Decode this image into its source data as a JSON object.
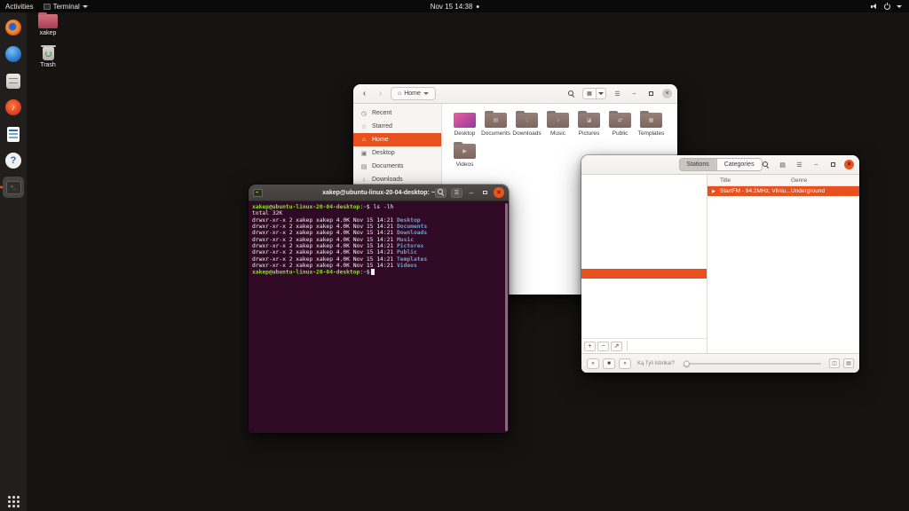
{
  "topbar": {
    "activities": "Activities",
    "app_name": "Terminal",
    "clock": "Nov 15 14:38"
  },
  "desktop": {
    "icons": [
      {
        "label": "xakep"
      },
      {
        "label": "Trash"
      }
    ]
  },
  "dock": {
    "apps": [
      "firefox",
      "thunderbird",
      "files",
      "rhythmbox",
      "libreoffice-writer",
      "help",
      "terminal"
    ],
    "bottom": "show-applications"
  },
  "files": {
    "location": "Home",
    "sidebar": [
      {
        "label": "Recent"
      },
      {
        "label": "Starred"
      },
      {
        "label": "Home",
        "selected": true
      },
      {
        "label": "Desktop"
      },
      {
        "label": "Documents"
      },
      {
        "label": "Downloads"
      }
    ],
    "folders": [
      {
        "name": "Desktop"
      },
      {
        "name": "Documents"
      },
      {
        "name": "Downloads"
      },
      {
        "name": "Music"
      },
      {
        "name": "Pictures"
      },
      {
        "name": "Public"
      },
      {
        "name": "Templates"
      },
      {
        "name": "Videos"
      }
    ]
  },
  "radio": {
    "tabs": {
      "stations": "Stations",
      "categories": "Categories"
    },
    "columns": {
      "title": "Title",
      "genre": "Genre"
    },
    "station": {
      "title": "StartFM - 94.2MHz, Vilniu...",
      "genre": "Underground"
    },
    "now_playing": "Ką Tyli Isbrikai?"
  },
  "terminal": {
    "title": "xakep@ubuntu-linux-20-04-desktop: ~",
    "user": "xakep@ubuntu-linux-20-04-desktop",
    "colon": ":",
    "path": "~",
    "dollar_cmd": "$ ls -lh",
    "dollar": "$",
    "total": "total 32K",
    "listing": [
      {
        "meta": "drwxr-xr-x 2 xakep xakep 4.0K Nov 15 14:21 ",
        "name": "Desktop"
      },
      {
        "meta": "drwxr-xr-x 2 xakep xakep 4.0K Nov 15 14:21 ",
        "name": "Documents"
      },
      {
        "meta": "drwxr-xr-x 2 xakep xakep 4.0K Nov 15 14:21 ",
        "name": "Downloads"
      },
      {
        "meta": "drwxr-xr-x 2 xakep xakep 4.0K Nov 15 14:21 ",
        "name": "Music"
      },
      {
        "meta": "drwxr-xr-x 2 xakep xakep 4.0K Nov 15 14:21 ",
        "name": "Pictures"
      },
      {
        "meta": "drwxr-xr-x 2 xakep xakep 4.0K Nov 15 14:21 ",
        "name": "Public"
      },
      {
        "meta": "drwxr-xr-x 2 xakep xakep 4.0K Nov 15 14:21 ",
        "name": "Templates"
      },
      {
        "meta": "drwxr-xr-x 2 xakep xakep 4.0K Nov 15 14:21 ",
        "name": "Videos"
      }
    ]
  },
  "icons": {
    "home": "⌂",
    "clock": "◷",
    "star": "☆",
    "screen": "▣",
    "doc": "▤",
    "down_arrow": "↓",
    "music": "♪",
    "pictures": "◪",
    "public": "⇄",
    "templates": "▦",
    "play": "▶",
    "back": "‹",
    "forward": "›",
    "hamburger": "☰",
    "minimize": "–",
    "close": "×",
    "grid": "▦",
    "list": "▤",
    "add": "+",
    "remove": "−",
    "edit": "↗",
    "prev": "«",
    "stop": "■",
    "next": "»",
    "queue": "▤",
    "volume": "◫",
    "question": "?",
    "note": "♪"
  }
}
